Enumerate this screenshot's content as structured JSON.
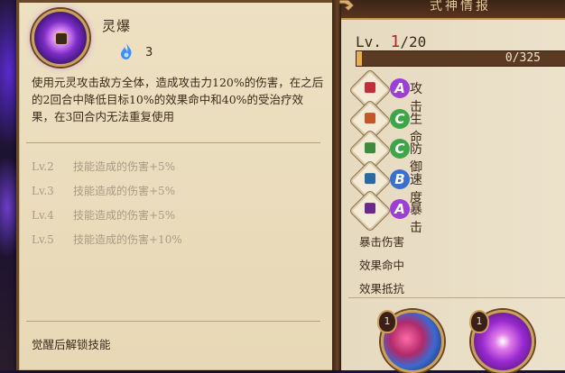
{
  "skill": {
    "name": "灵爆",
    "cost": "3",
    "description": "使用元灵攻击敌方全体，造成攻击力120%的伤害，在之后的2回合中降低目标10%的效果命中和40%的受治疗效果，在3回合内无法重复使用",
    "levels": [
      {
        "lv": "Lv.2",
        "text": "技能造成的伤害+5%"
      },
      {
        "lv": "Lv.3",
        "text": "技能造成的伤害+5%"
      },
      {
        "lv": "Lv.4",
        "text": "技能造成的伤害+5%"
      },
      {
        "lv": "Lv.5",
        "text": "技能造成的伤害+10%"
      }
    ],
    "unlock_text": "觉醒后解锁技能"
  },
  "panel": {
    "title": "式神情报",
    "level_prefix": "Lv.",
    "level_current": "1",
    "level_max": "/20",
    "xp_text": "0/325",
    "xp_fraction": 0.0,
    "stats": [
      {
        "grade": "A",
        "label": "攻击",
        "grade_color": "#9b3fd6",
        "icon": "attack-icon",
        "icon_color": "#c0303a"
      },
      {
        "grade": "C",
        "label": "生命",
        "grade_color": "#3ea548",
        "icon": "health-icon",
        "icon_color": "#c0582a"
      },
      {
        "grade": "C",
        "label": "防御",
        "grade_color": "#3ea548",
        "icon": "defense-icon",
        "icon_color": "#3e8a3e"
      },
      {
        "grade": "B",
        "label": "速度",
        "grade_color": "#3a6fd0",
        "icon": "speed-icon",
        "icon_color": "#2a6aa0"
      },
      {
        "grade": "A",
        "label": "暴击",
        "grade_color": "#9b3fd6",
        "icon": "crit-icon",
        "icon_color": "#6a2a8a"
      }
    ],
    "sub_stats": [
      "暴击伤害",
      "效果命中",
      "效果抵抗"
    ],
    "souls": [
      {
        "badge": "1",
        "icon": "soul-slot-icon-red"
      },
      {
        "badge": "1",
        "icon": "soul-slot-icon-purple"
      }
    ]
  }
}
